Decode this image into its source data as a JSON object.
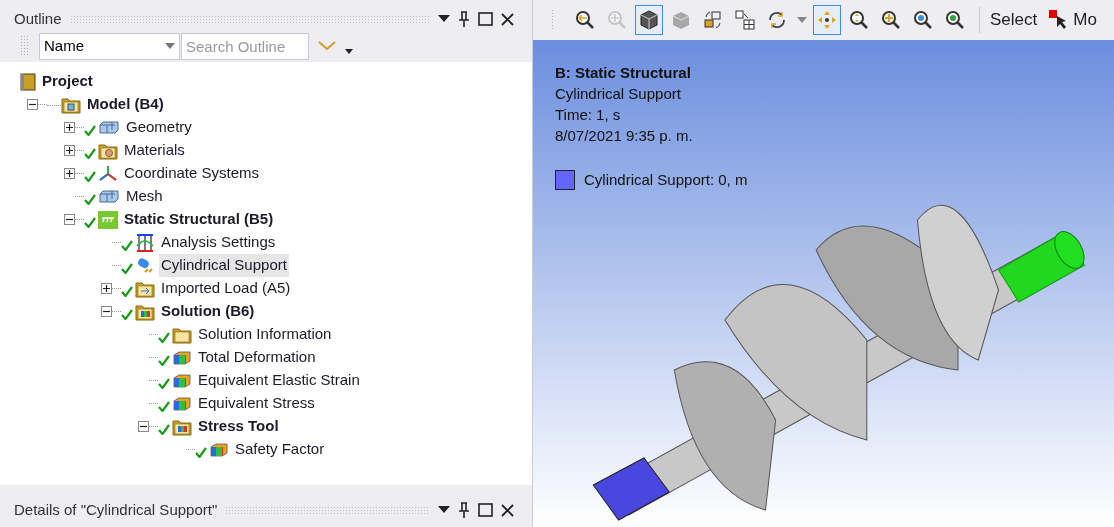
{
  "outline": {
    "title": "Outline",
    "filter": {
      "value": "Name"
    },
    "search": {
      "placeholder": "Search Outline"
    },
    "tree": [
      {
        "label": "Project",
        "kind": "project",
        "checked": false,
        "selected": false,
        "children": [
          {
            "label": "Model (B4)",
            "kind": "model",
            "checked": false,
            "selected": false,
            "expanded": true,
            "children": [
              {
                "label": "Geometry",
                "kind": "geometry",
                "checked": true,
                "selected": false,
                "expanded": false
              },
              {
                "label": "Materials",
                "kind": "materials",
                "checked": true,
                "selected": false,
                "expanded": false
              },
              {
                "label": "Coordinate Systems",
                "kind": "coordinates",
                "checked": true,
                "selected": false,
                "expanded": false
              },
              {
                "label": "Mesh",
                "kind": "mesh",
                "checked": true,
                "selected": false
              },
              {
                "label": "Static Structural (B5)",
                "kind": "analysis",
                "checked": true,
                "selected": false,
                "expanded": true,
                "children": [
                  {
                    "label": "Analysis Settings",
                    "kind": "settings",
                    "checked": true,
                    "selected": false
                  },
                  {
                    "label": "Cylindrical Support",
                    "kind": "support",
                    "checked": true,
                    "selected": true
                  },
                  {
                    "label": "Imported Load (A5)",
                    "kind": "load",
                    "checked": true,
                    "selected": false,
                    "expanded": false
                  },
                  {
                    "label": "Solution (B6)",
                    "kind": "solution",
                    "checked": true,
                    "selected": false,
                    "expanded": true,
                    "children": [
                      {
                        "label": "Solution Information",
                        "kind": "info",
                        "checked": true,
                        "selected": false
                      },
                      {
                        "label": "Total Deformation",
                        "kind": "result",
                        "checked": true,
                        "selected": false
                      },
                      {
                        "label": "Equivalent Elastic Strain",
                        "kind": "result",
                        "checked": true,
                        "selected": false
                      },
                      {
                        "label": "Equivalent Stress",
                        "kind": "result",
                        "checked": true,
                        "selected": false
                      },
                      {
                        "label": "Stress Tool",
                        "kind": "solution",
                        "checked": true,
                        "selected": false,
                        "expanded": true,
                        "children": [
                          {
                            "label": "Safety Factor",
                            "kind": "result",
                            "checked": true,
                            "selected": false
                          }
                        ]
                      }
                    ]
                  }
                ]
              }
            ]
          }
        ]
      }
    ]
  },
  "details": {
    "title": "Details of \"Cylindrical Support\""
  },
  "toolbar": {
    "buttons": [
      {
        "kind": "zoom-previous",
        "selected": false,
        "disabled": false
      },
      {
        "kind": "zoom-next",
        "selected": false,
        "disabled": true
      },
      {
        "kind": "shaded",
        "selected": true,
        "disabled": false
      },
      {
        "kind": "solid",
        "selected": false,
        "disabled": false
      },
      {
        "kind": "views",
        "selected": false,
        "disabled": false
      },
      {
        "kind": "graphics-grid",
        "selected": false,
        "disabled": false
      },
      {
        "kind": "rotate",
        "selected": false,
        "disabled": false
      },
      {
        "kind": "caret",
        "selected": false,
        "disabled": false
      },
      {
        "kind": "pan",
        "selected": true,
        "disabled": false
      },
      {
        "kind": "zoom",
        "selected": false,
        "disabled": false
      },
      {
        "kind": "zoom-in",
        "selected": false,
        "disabled": false
      },
      {
        "kind": "zoom-box",
        "selected": false,
        "disabled": false
      },
      {
        "kind": "zoom-fit",
        "selected": false,
        "disabled": false
      }
    ],
    "select_label": "Select",
    "mode_label": "Mo"
  },
  "viewport": {
    "title": "B: Static Structural",
    "lines": [
      "Cylindrical Support",
      "Time: 1, s",
      "8/07/2021 9:35 p. m."
    ],
    "legend": [
      {
        "label": "Cylindrical Support: 0, m",
        "color": "#6464ff"
      }
    ]
  }
}
